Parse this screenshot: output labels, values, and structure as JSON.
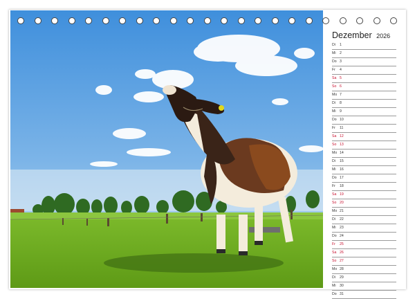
{
  "calendar": {
    "month": "Dezember",
    "year": "2026",
    "weekend_color": "#c8102e",
    "days": [
      {
        "wd": "Di",
        "d": "1",
        "red": false
      },
      {
        "wd": "Mi",
        "d": "2",
        "red": false
      },
      {
        "wd": "Do",
        "d": "3",
        "red": false
      },
      {
        "wd": "Fr",
        "d": "4",
        "red": false
      },
      {
        "wd": "Sa",
        "d": "5",
        "red": true
      },
      {
        "wd": "So",
        "d": "6",
        "red": true
      },
      {
        "wd": "Mo",
        "d": "7",
        "red": false
      },
      {
        "wd": "Di",
        "d": "8",
        "red": false
      },
      {
        "wd": "Mi",
        "d": "9",
        "red": false
      },
      {
        "wd": "Do",
        "d": "10",
        "red": false
      },
      {
        "wd": "Fr",
        "d": "11",
        "red": false
      },
      {
        "wd": "Sa",
        "d": "12",
        "red": true
      },
      {
        "wd": "So",
        "d": "13",
        "red": true
      },
      {
        "wd": "Mo",
        "d": "14",
        "red": false
      },
      {
        "wd": "Di",
        "d": "15",
        "red": false
      },
      {
        "wd": "Mi",
        "d": "16",
        "red": false
      },
      {
        "wd": "Do",
        "d": "17",
        "red": false
      },
      {
        "wd": "Fr",
        "d": "18",
        "red": false
      },
      {
        "wd": "Sa",
        "d": "19",
        "red": true
      },
      {
        "wd": "So",
        "d": "20",
        "red": true
      },
      {
        "wd": "Mo",
        "d": "21",
        "red": false
      },
      {
        "wd": "Di",
        "d": "22",
        "red": false
      },
      {
        "wd": "Mi",
        "d": "23",
        "red": false
      },
      {
        "wd": "Do",
        "d": "24",
        "red": false
      },
      {
        "wd": "Fr",
        "d": "25",
        "red": true
      },
      {
        "wd": "Sa",
        "d": "26",
        "red": true
      },
      {
        "wd": "So",
        "d": "27",
        "red": true
      },
      {
        "wd": "Mo",
        "d": "28",
        "red": false
      },
      {
        "wd": "Di",
        "d": "29",
        "red": false
      },
      {
        "wd": "Mi",
        "d": "30",
        "red": false
      },
      {
        "wd": "Do",
        "d": "31",
        "red": false
      }
    ]
  },
  "binding": {
    "hole_count": 23
  }
}
